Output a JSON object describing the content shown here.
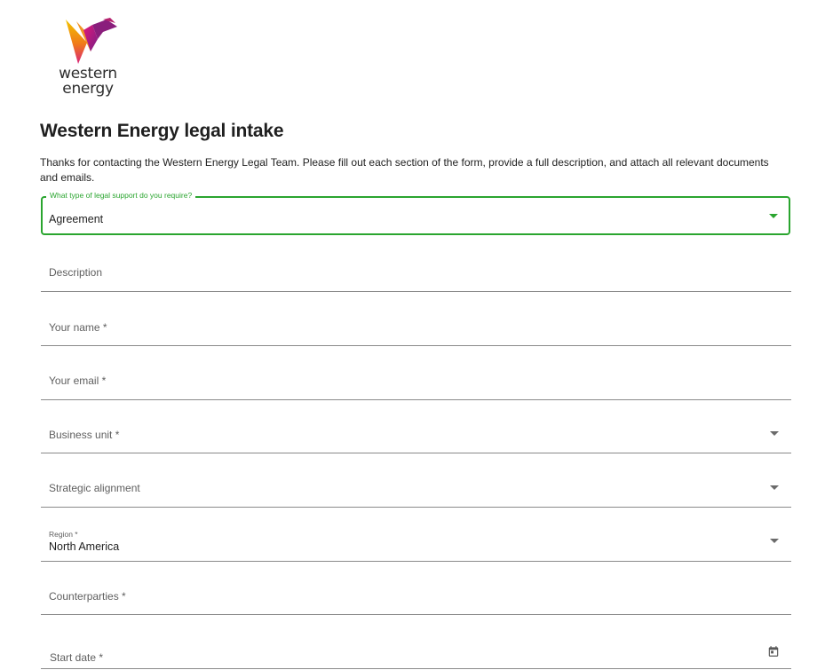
{
  "brand": {
    "logo_text": "western energy",
    "logo_line1": "western",
    "logo_line2": "energy"
  },
  "form": {
    "title": "Western Energy legal intake",
    "intro": "Thanks for contacting the Western Energy Legal Team. Please fill out each section of the form, provide a full description, and attach all relevant documents and emails.",
    "support_type": {
      "label": "What type of legal support do you require?",
      "value": "Agreement",
      "icon": "chevron-down-icon"
    },
    "description": {
      "label": "Description"
    },
    "your_name": {
      "label": "Your name *"
    },
    "your_email": {
      "label": "Your email *"
    },
    "business_unit": {
      "label": "Business unit *",
      "icon": "chevron-down-icon"
    },
    "strategic_alignment": {
      "label": "Strategic alignment",
      "icon": "chevron-down-icon"
    },
    "region": {
      "label": "Region *",
      "value": "North America",
      "icon": "chevron-down-icon"
    },
    "counterparties": {
      "label": "Counterparties *"
    },
    "start_date": {
      "label": "Start date *",
      "icon": "calendar-icon"
    }
  },
  "colors": {
    "accent_green": "#2aa52f",
    "text_dark": "#1f1f1f",
    "label_gray": "#5f5f5f",
    "underline": "#8a8a8a"
  }
}
